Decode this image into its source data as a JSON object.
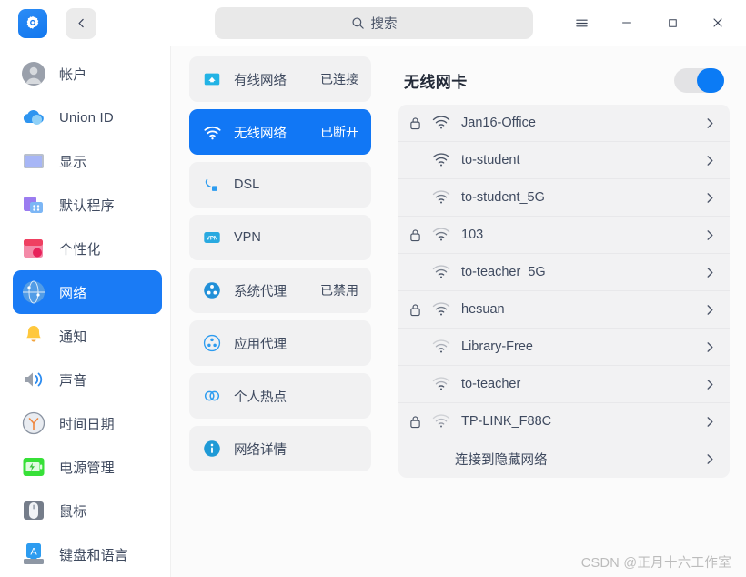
{
  "titlebar": {
    "app_icon": "gear-icon",
    "back_label": "‹",
    "search_placeholder": "搜索",
    "search_value": "",
    "menu_label": "≡",
    "minimize_label": "—",
    "maximize_label": "□",
    "close_label": "✕"
  },
  "sidebar": {
    "items": [
      {
        "label": "帐户",
        "icon": "account-icon",
        "active": false
      },
      {
        "label": "Union ID",
        "icon": "cloud-icon",
        "active": false
      },
      {
        "label": "显示",
        "icon": "display-icon",
        "active": false
      },
      {
        "label": "默认程序",
        "icon": "default-apps-icon",
        "active": false
      },
      {
        "label": "个性化",
        "icon": "personalize-icon",
        "active": false
      },
      {
        "label": "网络",
        "icon": "network-globe-icon",
        "active": true
      },
      {
        "label": "通知",
        "icon": "bell-icon",
        "active": false
      },
      {
        "label": "声音",
        "icon": "speaker-icon",
        "active": false
      },
      {
        "label": "时间日期",
        "icon": "clock-icon",
        "active": false
      },
      {
        "label": "电源管理",
        "icon": "battery-icon",
        "active": false
      },
      {
        "label": "鼠标",
        "icon": "mouse-icon",
        "active": false
      },
      {
        "label": "键盘和语言",
        "icon": "keyboard-icon",
        "active": false
      }
    ]
  },
  "midpanel": {
    "items": [
      {
        "label": "有线网络",
        "status": "已连接",
        "icon": "wired-network-icon",
        "active": false
      },
      {
        "label": "无线网络",
        "status": "已断开",
        "icon": "wifi-icon",
        "active": true
      },
      {
        "label": "DSL",
        "status": "",
        "icon": "dsl-icon",
        "active": false
      },
      {
        "label": "VPN",
        "status": "",
        "icon": "vpn-icon",
        "active": false
      },
      {
        "label": "系统代理",
        "status": "已禁用",
        "icon": "system-proxy-icon",
        "active": false
      },
      {
        "label": "应用代理",
        "status": "",
        "icon": "app-proxy-icon",
        "active": false
      },
      {
        "label": "个人热点",
        "status": "",
        "icon": "hotspot-icon",
        "active": false
      },
      {
        "label": "网络详情",
        "status": "",
        "icon": "info-icon",
        "active": false
      }
    ]
  },
  "rightpanel": {
    "title": "无线网卡",
    "toggle_on": true,
    "networks": [
      {
        "ssid": "Jan16-Office",
        "locked": true,
        "signal": 3
      },
      {
        "ssid": "to-student",
        "locked": false,
        "signal": 3
      },
      {
        "ssid": "to-student_5G",
        "locked": false,
        "signal": 2
      },
      {
        "ssid": "103",
        "locked": true,
        "signal": 2
      },
      {
        "ssid": "to-teacher_5G",
        "locked": false,
        "signal": 2
      },
      {
        "ssid": "hesuan",
        "locked": true,
        "signal": 2
      },
      {
        "ssid": "Library-Free",
        "locked": false,
        "signal": 1
      },
      {
        "ssid": "to-teacher",
        "locked": false,
        "signal": 1
      },
      {
        "ssid": "TP-LINK_F88C",
        "locked": true,
        "signal": 1
      }
    ],
    "hidden_network_label": "连接到隐藏网络"
  },
  "watermark": {
    "text": "CSDN @正月十六工作室"
  },
  "colors": {
    "accent": "#1177f5",
    "sidebar_active": "#1a7bf5",
    "panel_bg": "#fbfbfb",
    "item_bg": "#f1f1f2",
    "text": "#3f4a5f"
  }
}
